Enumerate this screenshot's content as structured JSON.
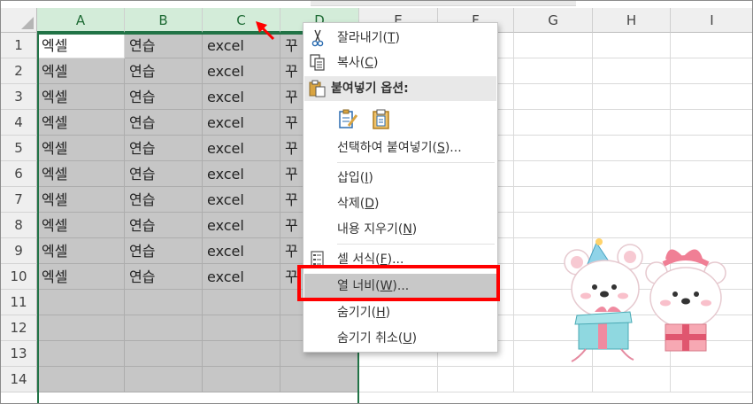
{
  "columns": [
    "A",
    "B",
    "C",
    "D",
    "E",
    "F",
    "G",
    "H",
    "I"
  ],
  "row_numbers": [
    "1",
    "2",
    "3",
    "4",
    "5",
    "6",
    "7",
    "8",
    "9",
    "10",
    "11",
    "12",
    "13",
    "14"
  ],
  "rows": [
    [
      "엑셀",
      "연습",
      "excel",
      "꾸"
    ],
    [
      "엑셀",
      "연습",
      "excel",
      "꾸"
    ],
    [
      "엑셀",
      "연습",
      "excel",
      "꾸"
    ],
    [
      "엑셀",
      "연습",
      "excel",
      "꾸"
    ],
    [
      "엑셀",
      "연습",
      "excel",
      "꾸"
    ],
    [
      "엑셀",
      "연습",
      "excel",
      "꾸"
    ],
    [
      "엑셀",
      "연습",
      "excel",
      "꾸"
    ],
    [
      "엑셀",
      "연습",
      "excel",
      "꾸"
    ],
    [
      "엑셀",
      "연습",
      "excel",
      "꾸"
    ],
    [
      "엑셀",
      "연습",
      "excel",
      "꾸"
    ]
  ],
  "context_menu": {
    "cut": {
      "label": "잘라내기(",
      "key": "T",
      "end": ")"
    },
    "copy": {
      "label": "복사(",
      "key": "C",
      "end": ")"
    },
    "paste_options": "붙여넣기 옵션:",
    "paste_special": {
      "label": "선택하여 붙여넣기(",
      "key": "S",
      "end": ")..."
    },
    "insert": {
      "label": "삽입(",
      "key": "I",
      "end": ")"
    },
    "delete": {
      "label": "삭제(",
      "key": "D",
      "end": ")"
    },
    "clear": {
      "label": "내용 지우기(",
      "key": "N",
      "end": ")"
    },
    "format_cells": {
      "label": "셀 서식(",
      "key": "F",
      "end": ")..."
    },
    "column_width": {
      "label": "열 너비(",
      "key": "W",
      "end": ")..."
    },
    "hide": {
      "label": "숨기기(",
      "key": "H",
      "end": ")"
    },
    "unhide": {
      "label": "숨기기 취소(",
      "key": "U",
      "end": ")"
    }
  },
  "colors": {
    "selection_green": "#217346",
    "highlight": "#ff0000",
    "selected_fill": "#c6c6c6"
  },
  "icons": [
    "scissors-icon",
    "copy-icon",
    "clipboard-icon",
    "paste-keep-format-icon",
    "paste-icon",
    "format-cells-icon"
  ]
}
